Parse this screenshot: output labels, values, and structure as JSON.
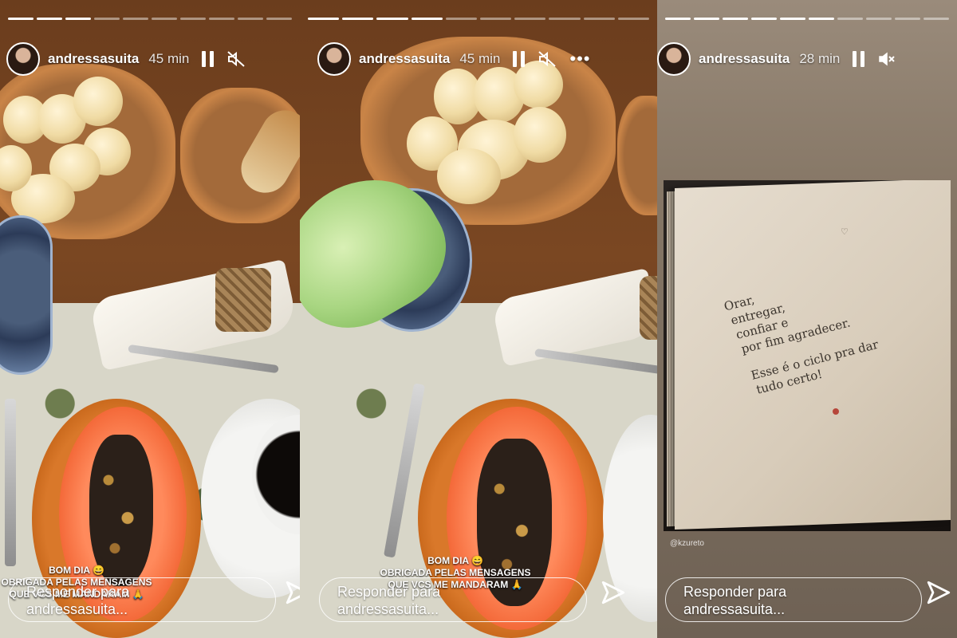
{
  "stories": [
    {
      "username": "andressasuita",
      "time": "45 min",
      "progress": {
        "segments": 10,
        "completed": 3
      },
      "caption_line1": "BOM DIA 😄",
      "caption_line2": "OBRIGADA PELAS MENSAGENS",
      "caption_line3": "QUE VCS ME MANDARAM 🙏",
      "reply_placeholder_line1": "Responder para",
      "reply_placeholder_line2": "andressasuita..."
    },
    {
      "username": "andressasuita",
      "time": "45 min",
      "progress": {
        "segments": 10,
        "completed": 4
      },
      "caption_line1": "BOM DIA 😄",
      "caption_line2": "OBRIGADA PELAS MENSAGENS",
      "caption_line3": "QUE VCS ME MANDARAM 🙏",
      "reply_placeholder_line1": "Responder para",
      "reply_placeholder_line2": "andressasuita..."
    },
    {
      "username": "andressasuita",
      "time": "28 min",
      "progress": {
        "segments": 10,
        "completed": 6
      },
      "poem": [
        "Orar,",
        "entregar,",
        "confiar e",
        "por fim agradecer.",
        "",
        "Esse é o ciclo pra dar",
        "tudo certo!"
      ],
      "credit": "@kzureto",
      "reply_placeholder_line1": "Responder para",
      "reply_placeholder_line2": "andressasuita..."
    }
  ],
  "icons": {
    "pause": "pause-icon",
    "mute": "muted-speaker-icon",
    "more": "more-options-icon",
    "send": "send-paper-plane-icon",
    "heart": "heart-icon"
  },
  "colors": {
    "text": "#ffffff",
    "reply_border": "#ffffff"
  }
}
